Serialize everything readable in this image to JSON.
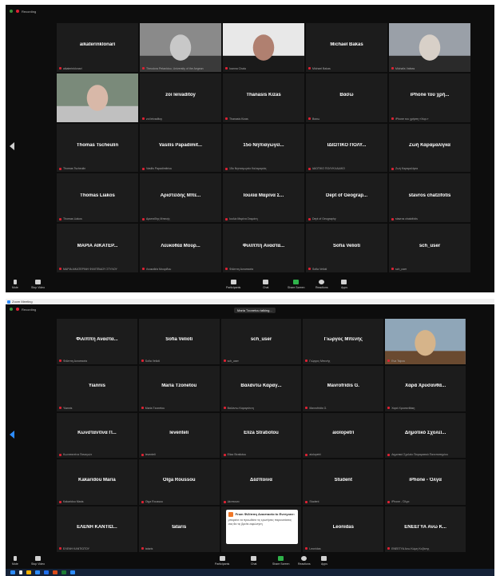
{
  "screenshot1": {
    "recording_label": "Recording",
    "tiles": [
      {
        "name": "aikaterinklonari",
        "label": "aikaterinklonari",
        "video": false
      },
      {
        "name": "",
        "label": "Theodora Petanidou, University of the Aegean",
        "video": true
      },
      {
        "name": "",
        "label": "Ioanna Chala",
        "video": true
      },
      {
        "name": "Michael Bakas",
        "label": "Michael Bakas",
        "video": false
      },
      {
        "name": "",
        "label": "Michalis Vafeas",
        "video": true
      },
      {
        "name": "",
        "label": "",
        "video": true
      },
      {
        "name": "zoi leivaditoy",
        "label": "zoi leivaditoy",
        "video": false
      },
      {
        "name": "Thanasis Kizas",
        "label": "Thanasis Kizas",
        "video": false
      },
      {
        "name": "Bασω",
        "label": "Bασω",
        "video": false
      },
      {
        "name": "iPhone του χρή...",
        "label": "iPhone του χρήστη «Χαρ.»",
        "video": false
      },
      {
        "name": "Thomas Tscheulin",
        "label": "Thomas Tscheulin",
        "video": false
      },
      {
        "name": "Vasilis Papadimit...",
        "label": "Vasilis Papadimitriou",
        "video": false
      },
      {
        "name": "15ο Νηπιαγωγεί...",
        "label": "15ο Νηπιαγωγείο Καλαμαριάς",
        "video": false
      },
      {
        "name": "ΙΔΙΩΤΙΚΟ ΠΟΛΥ...",
        "label": "ΙΔΙΩΤΙΚΟ ΠΟΛΥΚΛΑΔΙΚΟ",
        "video": false
      },
      {
        "name": "Ζωή Καραμαλίγκα",
        "label": "Ζωή Καραμαλίγκα",
        "video": false
      },
      {
        "name": "Thomas Liakos",
        "label": "Thomas Liakos",
        "video": false
      },
      {
        "name": "Αριστείδης Μπε...",
        "label": "Αριστείδης Μπενής",
        "video": false
      },
      {
        "name": "Ιουλία Μαρίνα Σ...",
        "label": "Ιουλία Μαρίνα Σταμάτη",
        "video": false
      },
      {
        "name": "Dept of Geograp...",
        "label": "Dept of Geography",
        "video": false
      },
      {
        "name": "stavros chatzifotis",
        "label": "stavros chatzifotis",
        "video": false
      },
      {
        "name": "ΜΑΡΙΑ ΑΙΚΑΤΕΡ...",
        "label": "ΜΑΡΙΑ ΑΙΚΑΤΕΡΙΝΗ ΦΙΛΙΠΠΙΔΟΥ ΣΤΥΛΟΥ",
        "video": false
      },
      {
        "name": "Λευκοθέα Μουρ...",
        "label": "Λευκοθέα Μουρίδου",
        "video": false
      },
      {
        "name": "Φιλίππη Αναστα...",
        "label": "Φιλίππη Αναστασία",
        "video": false
      },
      {
        "name": "Sofia Velioti",
        "label": "Sofia Velioti",
        "video": false
      },
      {
        "name": "sch_user",
        "label": "sch_user",
        "video": false
      }
    ],
    "toolbar": {
      "mute": "Mute",
      "stop_video": "Stop Video",
      "participants": "Participants",
      "participants_count": "45",
      "chat": "Chat",
      "share_screen": "Share Screen",
      "reactions": "Reactions",
      "apps": "Apps"
    }
  },
  "screenshot2": {
    "window_title": "Zoom Meeting",
    "recording_label": "Recording",
    "talking_label": "Maria Tzonetou talking...",
    "tiles": [
      {
        "name": "Φιλίππη Αναστα...",
        "label": "Φιλίππη Αναστασία",
        "video": false
      },
      {
        "name": "Sofia Velioti",
        "label": "Sofia Velioti",
        "video": false
      },
      {
        "name": "sch_user",
        "label": "sch_user",
        "video": false
      },
      {
        "name": "Γιώργος Μπενής",
        "label": "Γιώργος Μπενής",
        "video": false
      },
      {
        "name": "",
        "label": "Eva Tsipou",
        "video": true
      },
      {
        "name": "Yiannis",
        "label": "Yiannis",
        "video": false
      },
      {
        "name": "Maria Tzonetou",
        "label": "Maria Tzonetou",
        "video": false
      },
      {
        "name": "Βαλάντω Καραγ...",
        "label": "Βαλάντω Καραγιάννη",
        "video": false
      },
      {
        "name": "Mavrofridis G.",
        "label": "Mavrofridis G.",
        "video": false
      },
      {
        "name": "Χαρά Χρυσανθά...",
        "label": "Χαρά Χρυσανθάκη",
        "video": false
      },
      {
        "name": "Κωνσταντίνα Π...",
        "label": "Κωνσταντίνα Παναγιώτ",
        "video": false
      },
      {
        "name": "leventeli",
        "label": "leventeli",
        "video": false
      },
      {
        "name": "Eliza Stratiotou",
        "label": "Eliza Stratiotou",
        "video": false
      },
      {
        "name": "aiolopetri",
        "label": "aiolopetri",
        "video": false
      },
      {
        "name": "Δημοτικό Σχολεί...",
        "label": "Δημοτικό Σχολείο Πειραματικό Πανεπιστημίου",
        "video": false
      },
      {
        "name": "Kakaridou Maria",
        "label": "Kakaridou Maria",
        "video": false
      },
      {
        "name": "Olga Roussou",
        "label": "Olga Roussou",
        "video": false
      },
      {
        "name": "Δέσποινα",
        "label": "Δέσποινα",
        "video": false
      },
      {
        "name": "Student",
        "label": "Student",
        "video": false
      },
      {
        "name": "iPhone - Όλγα",
        "label": "iPhone - Όλγα",
        "video": false
      },
      {
        "name": "ΕΛΕΝΗ ΚΑΝΤΙΩ...",
        "label": "ΕΛΕΝΗ ΚΑΝΤΙΩΤΟΥ",
        "video": false
      },
      {
        "name": "tataris",
        "label": "tataris",
        "video": false
      },
      {
        "name": "",
        "label": "",
        "video": false,
        "chat_popup": true
      },
      {
        "name": "Leonidas",
        "label": "Leonidas",
        "video": false
      },
      {
        "name": "ΕΝΕΕΓΥΑ Ανω Κ...",
        "label": "ΕΝΕΕΓΥΑ Ανω Κώμη Κοζάνης",
        "video": false
      }
    ],
    "chat_popup": {
      "from": "From Φιλίππη Αναστασία to Everyone:",
      "message": "μπορείτε να προωθείτε τις ερωτήσεις παρουσιάσεις σας θα τις βρείτε εκφώνηση"
    },
    "toolbar": {
      "mute": "Mute",
      "stop_video": "Stop Video",
      "participants": "Participants",
      "participants_count": "45",
      "chat": "Chat",
      "share_screen": "Share Screen",
      "reactions": "Reactions",
      "apps": "Apps"
    }
  },
  "colors": {
    "tile_bg": "#1c1c1c",
    "window_bg": "#0d0d0d",
    "active_speaker": "#c8e34a",
    "share_green": "#2fb24a",
    "mic_red": "#dd2233",
    "taskbar": "#152238"
  }
}
